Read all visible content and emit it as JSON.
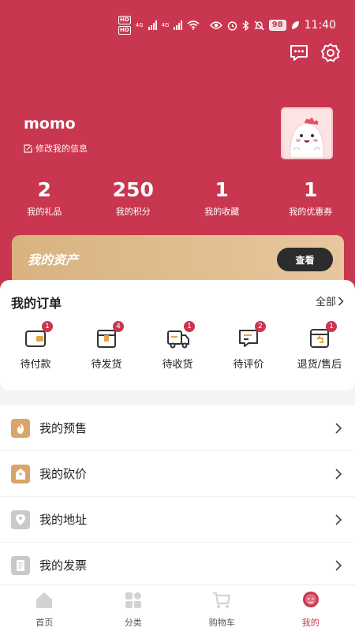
{
  "status_bar": {
    "hd_top": "HD",
    "hd_bottom": "HD",
    "net_type_1": "4G",
    "net_type_2": "4G",
    "battery": "98",
    "time": "11:40"
  },
  "header": {
    "username": "momo",
    "edit_label": "修改我的信息"
  },
  "stats": [
    {
      "value": "2",
      "label": "我的礼品"
    },
    {
      "value": "250",
      "label": "我的积分"
    },
    {
      "value": "1",
      "label": "我的收藏"
    },
    {
      "value": "1",
      "label": "我的优惠券"
    }
  ],
  "asset_card": {
    "title": "我的资产",
    "button": "查看"
  },
  "orders": {
    "title": "我的订单",
    "all_label": "全部",
    "items": [
      {
        "label": "待付款",
        "badge": "1",
        "icon": "wallet-icon"
      },
      {
        "label": "待发货",
        "badge": "4",
        "icon": "package-icon"
      },
      {
        "label": "待收货",
        "badge": "1",
        "icon": "truck-icon"
      },
      {
        "label": "待评价",
        "badge": "2",
        "icon": "comment-icon"
      },
      {
        "label": "退货/售后",
        "badge": "1",
        "icon": "return-icon"
      }
    ]
  },
  "menu": [
    {
      "label": "我的预售",
      "icon": "fire-icon",
      "color": "#d8a66a"
    },
    {
      "label": "我的砍价",
      "icon": "tag-icon",
      "color": "#d8a66a"
    },
    {
      "label": "我的地址",
      "icon": "location-icon",
      "color": "#c9c9c9"
    },
    {
      "label": "我的发票",
      "icon": "invoice-icon",
      "color": "#c9c9c9"
    }
  ],
  "tabbar": [
    {
      "label": "首页",
      "icon": "home-icon"
    },
    {
      "label": "分类",
      "icon": "category-icon"
    },
    {
      "label": "购物车",
      "icon": "cart-icon"
    },
    {
      "label": "我的",
      "icon": "profile-icon",
      "active": true
    }
  ],
  "colors": {
    "primary": "#c9364f",
    "gold": "#d9b27f",
    "dark_button": "#2c2c2c"
  }
}
